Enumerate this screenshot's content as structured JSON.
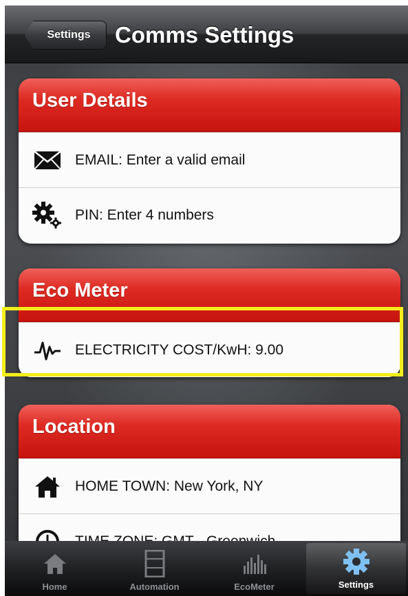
{
  "navbar": {
    "back_label": "Settings",
    "title": "Comms Settings"
  },
  "sections": [
    {
      "header": "User Details",
      "rows": [
        {
          "icon": "envelope-icon",
          "label": "EMAIL: Enter a valid email"
        },
        {
          "icon": "gears-icon",
          "label": "PIN: Enter 4 numbers"
        }
      ]
    },
    {
      "header": "Eco Meter",
      "rows": [
        {
          "icon": "pulse-icon",
          "label": "ELECTRICITY COST/KwH: 9.00"
        }
      ]
    },
    {
      "header": "Location",
      "rows": [
        {
          "icon": "house-icon",
          "label": "HOME TOWN: New York, NY"
        },
        {
          "icon": "clock-icon",
          "label": "TIME ZONE: GMT - Greenwich"
        }
      ]
    }
  ],
  "tabbar": {
    "tabs": [
      {
        "label": "Home",
        "icon": "house-icon",
        "active": false
      },
      {
        "label": "Automation",
        "icon": "film-strip-icon",
        "active": false
      },
      {
        "label": "EcoMeter",
        "icon": "bar-chart-icon",
        "active": false
      },
      {
        "label": "Settings",
        "icon": "gear-icon",
        "active": true
      }
    ]
  },
  "colors": {
    "header_red": "#dd2a22",
    "highlight_yellow": "#f4ee1a",
    "active_tab_icon": "#7fc0f2"
  }
}
